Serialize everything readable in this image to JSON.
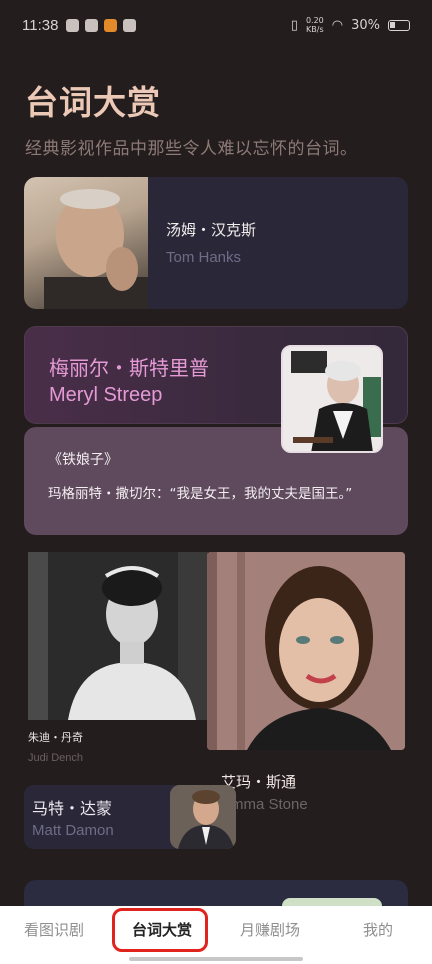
{
  "status_bar": {
    "time": "11:38",
    "speed": "0.20\nKB/s",
    "battery": "30%"
  },
  "header": {
    "title": "台词大赏",
    "subtitle": "经典影视作品中那些令人难以忘怀的台词。"
  },
  "cards": {
    "hanks": {
      "name_zh": "汤姆・汉克斯",
      "name_en": "Tom Hanks"
    },
    "streep": {
      "name_zh": "梅丽尔・斯特里普",
      "name_en": "Meryl Streep",
      "movie": "《铁娘子》",
      "quote": "玛格丽特・撒切尔：“我是女王，我的丈夫是国王。”"
    },
    "dench": {
      "name_zh": "朱迪・丹奇",
      "name_en": "Judi Dench"
    },
    "stone": {
      "name_zh": "艾玛・斯通",
      "name_en": "Emma Stone"
    },
    "damon": {
      "name_zh": "马特・达蒙",
      "name_en": "Matt Damon"
    }
  },
  "nav": {
    "tabs": [
      {
        "label": "看图识剧"
      },
      {
        "label": "台词大赏"
      },
      {
        "label": "月赚剧场"
      },
      {
        "label": "我的"
      }
    ],
    "active_index": 1
  },
  "colors": {
    "background": "#231d1d",
    "title": "#ecc8b6",
    "accent_pink": "#e49ad5",
    "active_ring": "#e0231c"
  }
}
